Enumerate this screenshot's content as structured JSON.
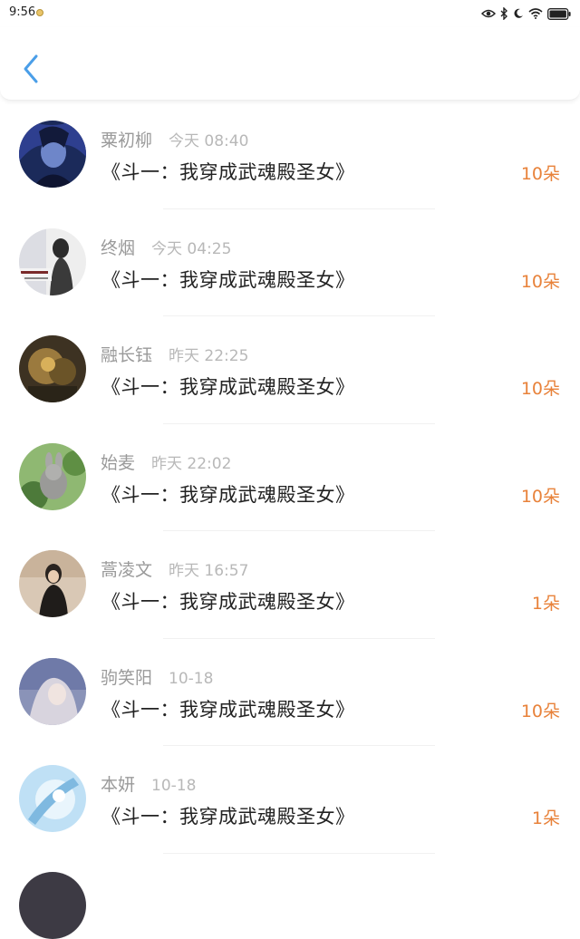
{
  "status_bar": {
    "time": "9:56",
    "icons": [
      "eye-icon",
      "bluetooth-icon",
      "moon-icon",
      "wifi-icon",
      "battery-icon"
    ]
  },
  "header": {
    "back_icon": "chevron-left-icon",
    "accent_color": "#4a9ee8"
  },
  "colors": {
    "name": "#9a9a9a",
    "time": "#b8b8b8",
    "title": "#222222",
    "count": "#e8823a"
  },
  "gifts": [
    {
      "name": "粟初柳",
      "time": "今天 08:40",
      "book": "《斗一：我穿成武魂殿圣女》",
      "count": "10朵"
    },
    {
      "name": "终烟",
      "time": "今天 04:25",
      "book": "《斗一：我穿成武魂殿圣女》",
      "count": "10朵"
    },
    {
      "name": "融长钰",
      "time": "昨天 22:25",
      "book": "《斗一：我穿成武魂殿圣女》",
      "count": "10朵"
    },
    {
      "name": "始麦",
      "time": "昨天 22:02",
      "book": "《斗一：我穿成武魂殿圣女》",
      "count": "10朵"
    },
    {
      "name": "蒿凌文",
      "time": "昨天 16:57",
      "book": "《斗一：我穿成武魂殿圣女》",
      "count": "1朵"
    },
    {
      "name": "驹笑阳",
      "time": "10-18",
      "book": "《斗一：我穿成武魂殿圣女》",
      "count": "10朵"
    },
    {
      "name": "本妍",
      "time": "10-18",
      "book": "《斗一：我穿成武魂殿圣女》",
      "count": "1朵"
    }
  ]
}
